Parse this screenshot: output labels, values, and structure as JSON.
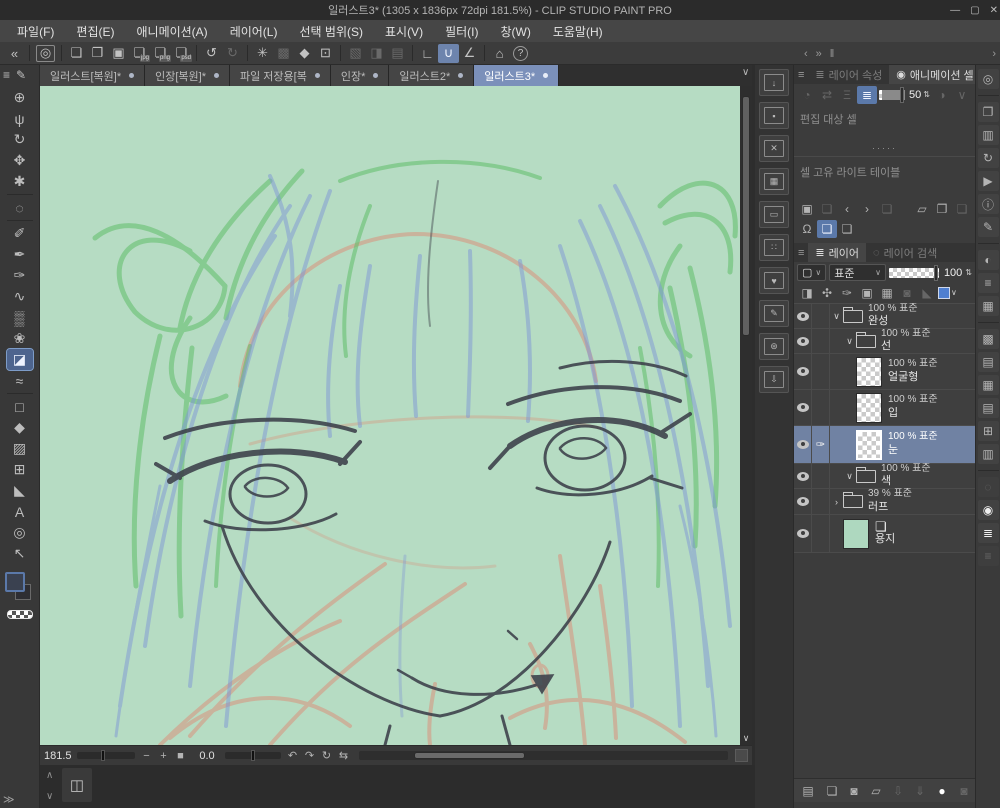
{
  "window": {
    "title": "일러스트3* (1305 x 1836px 72dpi 181.5%)  - CLIP STUDIO PAINT PRO",
    "minimize": "—",
    "maximize": "▢",
    "close": "✕"
  },
  "menubar": {
    "items": [
      {
        "name": "menu-file",
        "label": "파일(F)"
      },
      {
        "name": "menu-edit",
        "label": "편집(E)"
      },
      {
        "name": "menu-animation",
        "label": "애니메이션(A)"
      },
      {
        "name": "menu-layer",
        "label": "레이어(L)"
      },
      {
        "name": "menu-selection",
        "label": "선택 범위(S)"
      },
      {
        "name": "menu-view",
        "label": "표시(V)"
      },
      {
        "name": "menu-filter",
        "label": "필터(I)"
      },
      {
        "name": "menu-window",
        "label": "창(W)"
      },
      {
        "name": "menu-help",
        "label": "도움말(H)"
      }
    ]
  },
  "icons": {
    "collapse": "«",
    "logo": "◎",
    "newfile": "❏",
    "open": "❐",
    "save": "▣",
    "undo": "↺",
    "redo": "↻",
    "deselect": "✳",
    "reselect": "▩",
    "fillop": "◆",
    "crop": "⊡",
    "selA": "▧",
    "selB": "◨",
    "selC": "▤",
    "snap1": "∟",
    "snap2": "∪",
    "snap3": "∠",
    "tips": "⌂",
    "help": "?",
    "hamburger": "≡",
    "pen": "✎",
    "magnifier": "⊕",
    "hand": "ψ",
    "rotate": "↻",
    "move": "✥",
    "operation": "✱",
    "lasso": "◌",
    "eyedropper": "✐",
    "pen2": "✒",
    "pencil": "✑",
    "brush": "∿",
    "airbrush": "▒",
    "decoration": "❀",
    "eraser": "◪",
    "blend": "≈",
    "figure": "□",
    "fill": "◆",
    "gradient": "▨",
    "frame": "⊞",
    "ruler": "◣",
    "text": "A",
    "balloon": "◎",
    "correct": "↖",
    "minus": "−",
    "plus": "+",
    "square": "■",
    "undo2": "↶",
    "redo2": "↷",
    "reset": "↻",
    "flip": "⇆",
    "chevup": "∧",
    "chevdown": "∨",
    "chevleft": "‹",
    "chevright": "›",
    "chevsr": "»",
    "dblright": "≫",
    "film": "◫",
    "handle": "‖",
    "down": "↓",
    "save2": "▪",
    "x": "✕",
    "pattern": "▦",
    "frame2": "▭",
    "dots": "∷",
    "heart": "♥",
    "edit": "✎",
    "world": "⊛",
    "tray": "⇩",
    "quick": "◎",
    "subview": "❐",
    "itembank": "▥",
    "autoaction": "↻",
    "play": "▶",
    "info": "ⓘ",
    "story": "✎",
    "cwheel": "◐",
    "sliders": "≡",
    "cset": "▦",
    "tone": "▩",
    "lprop": "▤",
    "grid2": "▦",
    "filmicon": "▤",
    "node": "⊞",
    "material": "▥",
    "search": "◌",
    "bulb": "◉",
    "layers": "≣",
    "layercomp": "≡",
    "clock": "◔",
    "fliph": "⇄",
    "onion": "Ξ",
    "colorov": "◑",
    "vee": "∨",
    "spin": "⇅",
    "prev": "‹",
    "next": "›",
    "folder_open": "▱",
    "replace": "❐",
    "person": "Ω",
    "cel": "❏",
    "clip": "◨",
    "ref": "✣",
    "draft": "✑",
    "lockicon": "▣",
    "alpha": "▦",
    "maskdim": "◙",
    "rulermini": "◣",
    "newdlg": "◙",
    "transfer": "⇩",
    "merge": "⇓",
    "circle": "●",
    "shape": "▢"
  },
  "toolbar": {
    "items": [
      {
        "name": "collapse-toolbar-button",
        "glyph": "collapse"
      },
      {
        "sep": true
      },
      {
        "name": "csp-logo-button",
        "glyph": "logo",
        "state": "boxed"
      },
      {
        "sep": true
      },
      {
        "name": "new-file-button",
        "glyph": "newfile"
      },
      {
        "name": "open-file-button",
        "glyph": "open"
      },
      {
        "name": "save-file-button",
        "glyph": "save"
      },
      {
        "name": "export-jpg-button",
        "glyph": "newfile",
        "label": "jpg",
        "state": "doc"
      },
      {
        "name": "export-png-button",
        "glyph": "newfile",
        "label": "png",
        "state": "doc"
      },
      {
        "name": "export-psd-button",
        "glyph": "newfile",
        "label": "psd",
        "state": "doc"
      },
      {
        "sep": true
      },
      {
        "name": "undo-button",
        "glyph": "undo"
      },
      {
        "name": "redo-button",
        "glyph": "redo",
        "state": "dim"
      },
      {
        "sep": true
      },
      {
        "name": "deselect-button",
        "glyph": "deselect"
      },
      {
        "name": "reselect-button",
        "glyph": "reselect",
        "state": "dim"
      },
      {
        "name": "fill-button",
        "glyph": "fillop"
      },
      {
        "name": "crop-button",
        "glyph": "crop"
      },
      {
        "sep": true
      },
      {
        "name": "convert-selection-button",
        "glyph": "selA",
        "state": "dim"
      },
      {
        "name": "selection-launcher-button",
        "glyph": "selB",
        "state": "dim"
      },
      {
        "name": "selection-border-button",
        "glyph": "selC",
        "state": "dim"
      },
      {
        "sep": true
      },
      {
        "name": "snap-to-ruler-button",
        "glyph": "snap1"
      },
      {
        "name": "snap-to-special-ruler-button",
        "glyph": "snap2",
        "state": "active"
      },
      {
        "name": "snap-to-grid-button",
        "glyph": "snap3"
      },
      {
        "sep": true
      },
      {
        "name": "tips-button",
        "glyph": "tips"
      },
      {
        "name": "help-button",
        "glyph": "help",
        "state": "round"
      }
    ]
  },
  "tabs": {
    "items": [
      {
        "label": "일러스트[복원]*",
        "active": false
      },
      {
        "label": "인장[복원]*",
        "active": false
      },
      {
        "label": "파일 저장용[복",
        "active": false
      },
      {
        "label": "인장*",
        "active": false
      },
      {
        "label": "일러스트2*",
        "active": false
      },
      {
        "label": "일러스트3*",
        "active": true
      }
    ]
  },
  "tools": {
    "items": [
      {
        "name": "zoom-tool",
        "glyph": "magnifier"
      },
      {
        "name": "hand-tool",
        "glyph": "hand"
      },
      {
        "name": "rotate-canvas-tool",
        "glyph": "rotate"
      },
      {
        "name": "move-layer-tool",
        "glyph": "move"
      },
      {
        "name": "operation-tool",
        "glyph": "operation"
      },
      {
        "sep": true
      },
      {
        "name": "lasso-tool",
        "glyph": "lasso"
      },
      {
        "sep": true
      },
      {
        "name": "eyedropper-tool",
        "glyph": "eyedropper"
      },
      {
        "name": "pen-tool",
        "glyph": "pen2"
      },
      {
        "name": "pencil-tool",
        "glyph": "pencil"
      },
      {
        "name": "brush-tool",
        "glyph": "brush"
      },
      {
        "name": "airbrush-tool",
        "glyph": "airbrush"
      },
      {
        "name": "decoration-tool",
        "glyph": "decoration"
      },
      {
        "name": "eraser-tool",
        "glyph": "eraser",
        "state": "selected"
      },
      {
        "name": "blend-tool",
        "glyph": "blend"
      },
      {
        "sep": true
      },
      {
        "name": "figure-tool",
        "glyph": "figure"
      },
      {
        "name": "fill-tool",
        "glyph": "fill"
      },
      {
        "name": "gradient-tool",
        "glyph": "gradient"
      },
      {
        "name": "frame-border-tool",
        "glyph": "frame"
      },
      {
        "name": "ruler-tool",
        "glyph": "ruler"
      },
      {
        "name": "text-tool",
        "glyph": "text"
      },
      {
        "name": "balloon-tool",
        "glyph": "balloon"
      },
      {
        "name": "correct-line-tool",
        "glyph": "correct"
      }
    ]
  },
  "material_rail": {
    "items": [
      {
        "name": "material-download-folder",
        "glyph": "down"
      },
      {
        "name": "material-save-folder",
        "glyph": "save2"
      },
      {
        "name": "material-delete-folder",
        "glyph": "x"
      },
      {
        "name": "material-pattern-folder",
        "glyph": "pattern"
      },
      {
        "name": "material-frame-folder",
        "glyph": "frame2"
      },
      {
        "name": "material-tone-folder",
        "glyph": "dots"
      },
      {
        "name": "material-favorites-folder",
        "glyph": "heart"
      },
      {
        "name": "material-edit-folder",
        "glyph": "edit"
      },
      {
        "name": "material-cloud-folder",
        "glyph": "world"
      },
      {
        "name": "material-tray-folder",
        "glyph": "tray"
      }
    ]
  },
  "far_rail": {
    "items": [
      {
        "name": "quick-access-panel-button",
        "glyph": "quick"
      },
      {
        "sep": true
      },
      {
        "name": "sub-view-panel-button",
        "glyph": "subview"
      },
      {
        "name": "item-bank-panel-button",
        "glyph": "itembank"
      },
      {
        "name": "auto-action-panel-button",
        "glyph": "autoaction"
      },
      {
        "name": "timeline-panel-button",
        "glyph": "play"
      },
      {
        "name": "information-panel-button",
        "glyph": "info"
      },
      {
        "name": "story-panel-button",
        "glyph": "story"
      },
      {
        "sep": true
      },
      {
        "name": "color-wheel-panel-button",
        "glyph": "cwheel"
      },
      {
        "name": "color-slider-panel-button",
        "glyph": "sliders"
      },
      {
        "name": "color-set-panel-button",
        "glyph": "cset"
      },
      {
        "sep": true
      },
      {
        "name": "tone-panel-button",
        "glyph": "tone"
      },
      {
        "name": "layer-property-panel-button",
        "glyph": "lprop"
      },
      {
        "name": "layer-template-panel-button",
        "glyph": "grid2"
      },
      {
        "name": "animation-panel-button",
        "glyph": "filmicon"
      },
      {
        "name": "node-panel-button",
        "glyph": "node"
      },
      {
        "name": "material-panel-button",
        "glyph": "material"
      },
      {
        "sep": true
      },
      {
        "name": "layer-search-panel-button",
        "glyph": "search",
        "state": "dim"
      },
      {
        "name": "animation-cel-panel-button",
        "glyph": "bulb",
        "state": "on"
      },
      {
        "name": "layer-panel-button",
        "glyph": "layers",
        "state": "on"
      },
      {
        "name": "layer-comp-panel-button",
        "glyph": "layercomp",
        "state": "dim"
      }
    ]
  },
  "panels": {
    "animation_cel": {
      "tab_layer_property": "레이어 속성",
      "tab_animation_cel": "애니메이션 셀",
      "opacity": "50",
      "edit_target_label": "편집 대상 셀",
      "light_table_label": "셀 고유 라이트 테이블",
      "ctrl_icons": {
        "items": [
          {
            "name": "playback-time-button",
            "glyph": "clock",
            "state": "dim"
          },
          {
            "name": "flip-view-button",
            "glyph": "fliph",
            "state": "dim"
          },
          {
            "name": "onion-skin-button",
            "glyph": "onion",
            "state": "dim"
          },
          {
            "name": "enable-light-table-button",
            "glyph": "layers",
            "state": "active"
          }
        ]
      },
      "ctrl_icons2": {
        "items": [
          {
            "name": "overlay-color-button",
            "glyph": "colorov",
            "state": "dim"
          },
          {
            "name": "overlay-color-chevron",
            "glyph": "vee",
            "state": "dim"
          }
        ]
      },
      "cel_row1": {
        "items": [
          {
            "name": "register-image-as-cel-button",
            "glyph": "save"
          },
          {
            "name": "register-cel-button",
            "glyph": "newfile",
            "state": "dim"
          },
          {
            "name": "previous-cel-button",
            "glyph": "prev"
          },
          {
            "name": "next-cel-button",
            "glyph": "next"
          },
          {
            "name": "delete-registered-cel-button",
            "glyph": "newfile",
            "state": "dim"
          },
          {
            "sep": true
          },
          {
            "name": "open-cel-folder-button",
            "glyph": "folder_open"
          },
          {
            "name": "replace-cel-button",
            "glyph": "replace"
          },
          {
            "name": "remove-cel-button",
            "glyph": "newfile",
            "state": "dim"
          }
        ]
      },
      "cel_row2": {
        "items": [
          {
            "name": "onion-skin-settings-button",
            "glyph": "person"
          },
          {
            "name": "light-table-cel-button",
            "glyph": "cel",
            "state": "active"
          },
          {
            "name": "copy-cel-button",
            "glyph": "cel"
          }
        ]
      }
    },
    "layer": {
      "tab_layer": "레이어",
      "tab_search": "레이어 검색",
      "blend_mode": "표준",
      "opacity": "100",
      "lock_icons": {
        "items": [
          {
            "name": "clip-to-layer-below-button",
            "glyph": "clip"
          },
          {
            "name": "reference-layer-button",
            "glyph": "ref"
          },
          {
            "name": "draft-layer-button",
            "glyph": "draft"
          },
          {
            "name": "lock-layer-button",
            "glyph": "lockicon"
          },
          {
            "name": "lock-transparent-pixels-button",
            "glyph": "alpha"
          },
          {
            "name": "enable-mask-button",
            "glyph": "maskdim",
            "state": "dim"
          },
          {
            "name": "ruler-range-button",
            "glyph": "rulermini",
            "state": "dim"
          }
        ]
      },
      "footer_icons": {
        "items": [
          {
            "name": "panel-display-settings-button",
            "glyph": "lprop"
          },
          {
            "sep": true
          },
          {
            "name": "new-raster-layer-button",
            "glyph": "newfile"
          },
          {
            "name": "new-layer-dialog-button",
            "glyph": "newdlg"
          },
          {
            "name": "new-folder-button",
            "glyph": "folder_open"
          },
          {
            "name": "transfer-to-lower-layer-button",
            "glyph": "transfer",
            "state": "dim"
          },
          {
            "name": "merge-with-lower-layer-button",
            "glyph": "merge",
            "state": "dim"
          },
          {
            "name": "create-mask-button",
            "glyph": "circle",
            "state": "bright"
          },
          {
            "name": "apply-mask-button",
            "glyph": "maskdim",
            "state": "dim"
          }
        ]
      },
      "rows": [
        {
          "type": "folder",
          "info": "100 % 표준",
          "name": "완성"
        },
        {
          "type": "folder",
          "info": "100 % 표준",
          "name": "선"
        },
        {
          "type": "layer",
          "info": "100 % 표준",
          "name": "얼굴형"
        },
        {
          "type": "layer",
          "info": "100 % 표준",
          "name": "입"
        },
        {
          "type": "layer",
          "info": "100 % 표준",
          "name": "눈",
          "selected": true
        },
        {
          "type": "folder",
          "info": "100 % 표준",
          "name": "색"
        },
        {
          "type": "folder",
          "info": "39 % 표준",
          "name": "러프",
          "collapsed": true
        },
        {
          "type": "paper",
          "info": "",
          "name": "용지"
        }
      ]
    }
  },
  "statusbar": {
    "zoom_value": "181.5",
    "rotation_value": "0.0",
    "zoom_buttons": {
      "items": [
        {
          "name": "zoom-out-button",
          "glyph": "minus"
        },
        {
          "name": "zoom-in-button",
          "glyph": "plus"
        },
        {
          "name": "fit-to-screen-button",
          "glyph": "square"
        }
      ]
    },
    "rotate_buttons": {
      "items": [
        {
          "name": "rotate-left-button",
          "glyph": "undo2"
        },
        {
          "name": "rotate-right-button",
          "glyph": "redo2"
        },
        {
          "name": "reset-rotation-button",
          "glyph": "reset"
        },
        {
          "name": "flip-horizontal-button",
          "glyph": "flip"
        }
      ]
    }
  },
  "canvas": {
    "colors": {
      "background": "#b6dcc3",
      "rough_salmon": "#dd8b74",
      "ribbon_green": "#5fbd68",
      "hair_blue": "#7e95d6",
      "line_dark": "#3c3f49"
    }
  }
}
